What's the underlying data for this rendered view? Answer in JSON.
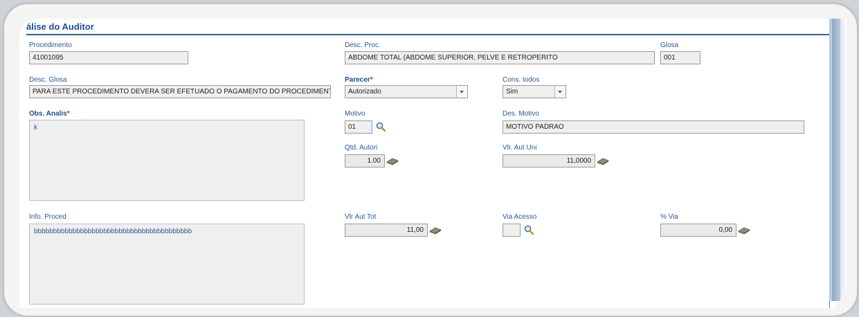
{
  "section": {
    "title": "álise do Auditor"
  },
  "procedimento": {
    "label": "Procedimento",
    "value": "41001095"
  },
  "desc_proc": {
    "label": "Desc. Proc.",
    "value": "ABDOME TOTAL (ABDOME SUPERIOR, PELVE E RETROPERITO"
  },
  "glosa": {
    "label": "Glosa",
    "value": "001"
  },
  "desc_glosa": {
    "label": "Desc. Glosa",
    "value": "PARA ESTE PROCEDIMENTO DEVERA SER EFETUADO O PAGAMENTO DO PROCEDIMENTO NO"
  },
  "parecer": {
    "label": "Parecer",
    "required": "*",
    "value": "Autorizado"
  },
  "cons_todos": {
    "label": "Cons. todos",
    "value": "Sim"
  },
  "obs_analis": {
    "label": "Obs. Analis",
    "required": "*",
    "value": "k"
  },
  "motivo": {
    "label": "Motivo",
    "value": "01"
  },
  "des_motivo": {
    "label": "Des. Motivo",
    "value": "MOTIVO PADRAO"
  },
  "qtd_autori": {
    "label": "Qtd. Autori",
    "value": "1.00"
  },
  "vlr_aut_uni": {
    "label": "Vlr. Aut Uni",
    "value": "11,0000"
  },
  "info_proced": {
    "label": "Info. Proced",
    "value": "bbbbbbbbbbbbbbbbbbbbbbbbbbbbbbbbbbbbbbbbb"
  },
  "vlr_aut_tot": {
    "label": "Vlr Aut Tot",
    "value": "11,00"
  },
  "via_acesso": {
    "label": "Via Acesso",
    "value": ""
  },
  "pct_via": {
    "label": "% Via",
    "value": "0,00"
  }
}
